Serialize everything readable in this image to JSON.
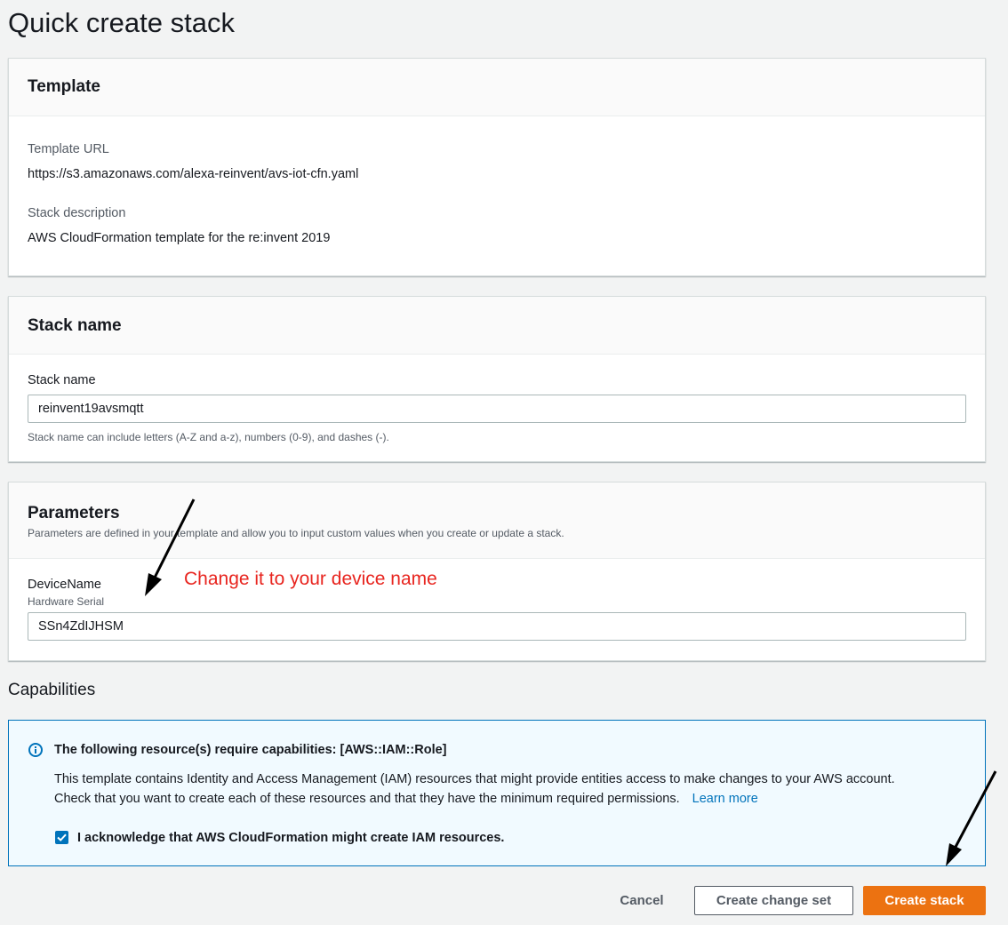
{
  "page": {
    "title": "Quick create stack"
  },
  "template_section": {
    "header": "Template",
    "url_label": "Template URL",
    "url_value": "https://s3.amazonaws.com/alexa-reinvent/avs-iot-cfn.yaml",
    "desc_label": "Stack description",
    "desc_value": "AWS CloudFormation template for the re:invent 2019"
  },
  "stack_name_section": {
    "header": "Stack name",
    "field_label": "Stack name",
    "field_value": "reinvent19avsmqtt",
    "hint": "Stack name can include letters (A-Z and a-z), numbers (0-9), and dashes (-)."
  },
  "parameters_section": {
    "header": "Parameters",
    "subheader": "Parameters are defined in your template and allow you to input custom values when you create or update a stack.",
    "field_label": "DeviceName",
    "field_sublabel": "Hardware Serial",
    "field_value": "SSn4ZdIJHSM"
  },
  "annotation": {
    "text": "Change it to your device name",
    "color": "#e8251f"
  },
  "capabilities": {
    "title": "Capabilities",
    "info_icon": "info-icon",
    "heading": "The following resource(s) require capabilities: [AWS::IAM::Role]",
    "body_line1": "This template contains Identity and Access Management (IAM) resources that might provide entities access to make changes to your AWS account.",
    "body_line2": "Check that you want to create each of these resources and that they have the minimum required permissions.",
    "learn_more": "Learn more",
    "acknowledge_label": "I acknowledge that AWS CloudFormation might create IAM resources.",
    "acknowledged": true
  },
  "actions": {
    "cancel": "Cancel",
    "create_change_set": "Create change set",
    "create_stack": "Create stack"
  },
  "colors": {
    "primary": "#ec7211",
    "link": "#0073bb",
    "checkbox": "#0073bb"
  }
}
